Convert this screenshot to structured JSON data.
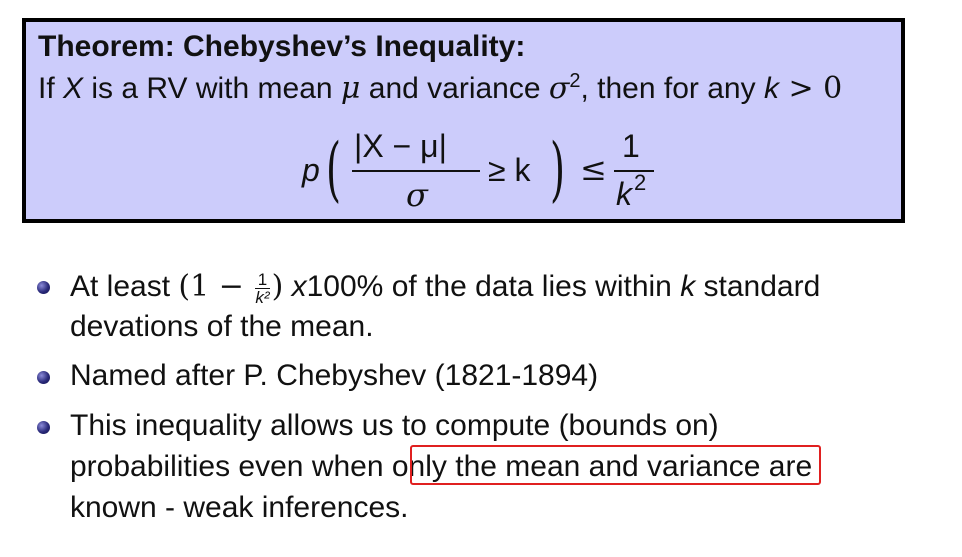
{
  "theorem": {
    "title": "Theorem: Chebyshev’s Inequality:",
    "statement": {
      "s1": "If ",
      "X": "X",
      "s2": " is a RV with mean ",
      "mu": "μ",
      "s3": " and variance ",
      "sigma": "σ",
      "sq": "2",
      "s4": ", then for any ",
      "k": "k",
      "s5": " > 0"
    },
    "formula": {
      "p": "p",
      "lparen": "(",
      "numerator": "|X − μ|",
      "denominator": "σ",
      "geq_k": "≥ k",
      "rparen": ")",
      "leq": "≤",
      "rhs_num": "1",
      "rhs_den": "k",
      "rhs_exp": "2"
    }
  },
  "bullets": [
    {
      "line1_a": "At least ",
      "line1_paren_open": "(1 − ",
      "frac_num": "1",
      "frac_den": "k²",
      "line1_paren_close": ")",
      "line1_x": " x",
      "line1_b": "100% of the data lies within ",
      "line1_k": "k",
      "line1_c": " standard",
      "line2": "devations of the mean."
    },
    {
      "line1": "Named after P. Chebyshev (1821-1894)"
    },
    {
      "line1": "This inequality allows us to compute (bounds on)",
      "line2_a": "probabilities even when ",
      "line2_highlight": "only the mean and variance",
      "line2_b": " are",
      "line3": "known - weak inferences."
    }
  ],
  "colors": {
    "theorem_bg": "#ccccfb",
    "highlight_border": "#e02020",
    "bullet": "#2a2a7a"
  }
}
